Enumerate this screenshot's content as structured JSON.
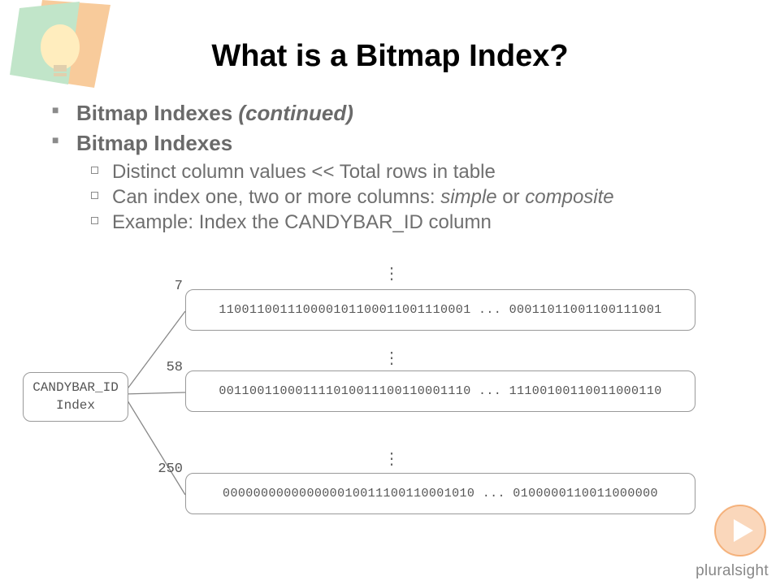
{
  "slide": {
    "title": "What is a Bitmap Index?",
    "bullets": {
      "item1_prefix": "Bitmap Indexes ",
      "item1_italic": "(continued)",
      "item2": "Bitmap Indexes",
      "sub1": "Distinct column values << Total rows in table",
      "sub2_a": "Can index one, two or more columns: ",
      "sub2_i1": "simple",
      "sub2_b": " or ",
      "sub2_i2": "composite",
      "sub3": "Example: Index the CANDYBAR_ID column"
    }
  },
  "diagram": {
    "index_label_line1": "CANDYBAR_ID",
    "index_label_line2": "Index",
    "rows": {
      "0": {
        "key": "7",
        "bits": "110011001110000101100011001110001 ... 00011011001100111001"
      },
      "1": {
        "key": "58",
        "bits": "001100110001111010011100110001110 ... 11100100110011000110"
      },
      "2": {
        "key": "250",
        "bits": "000000000000000010011100110001010 ... 0100000110011000000"
      }
    },
    "vdots": "⋮"
  },
  "brand": {
    "name": "pluralsight"
  }
}
